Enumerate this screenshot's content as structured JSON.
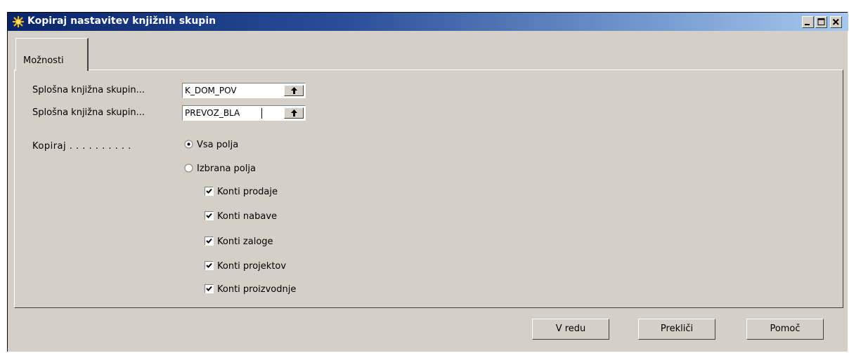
{
  "window": {
    "title": "Kopiraj nastavitev knjižnih skupin",
    "icon": "nav-sun-icon"
  },
  "tabs": [
    {
      "label": "Možnosti",
      "active": true
    }
  ],
  "fields": [
    {
      "label": "Splošna knjižna skupin...",
      "value": "K_DOM_POV"
    },
    {
      "label": "Splošna knjižna skupin...",
      "value": "PREVOZ_BLA"
    }
  ],
  "copy": {
    "label": "Kopiraj . . . . . . . . . .",
    "options": [
      {
        "label": "Vsa polja",
        "selected": true
      },
      {
        "label": "Izbrana polja",
        "selected": false
      }
    ],
    "checkboxes": [
      {
        "label": "Konti prodaje",
        "checked": true
      },
      {
        "label": "Konti nabave",
        "checked": true
      },
      {
        "label": "Konti zaloge",
        "checked": true
      },
      {
        "label": "Konti projektov",
        "checked": true
      },
      {
        "label": "Konti proizvodnje",
        "checked": true
      }
    ]
  },
  "buttons": {
    "ok": "V redu",
    "cancel": "Prekliči",
    "help": "Pomoč"
  },
  "colors": {
    "titlebar_start": "#0a246a",
    "titlebar_end": "#a6caf0",
    "face": "#d4d0c8"
  }
}
